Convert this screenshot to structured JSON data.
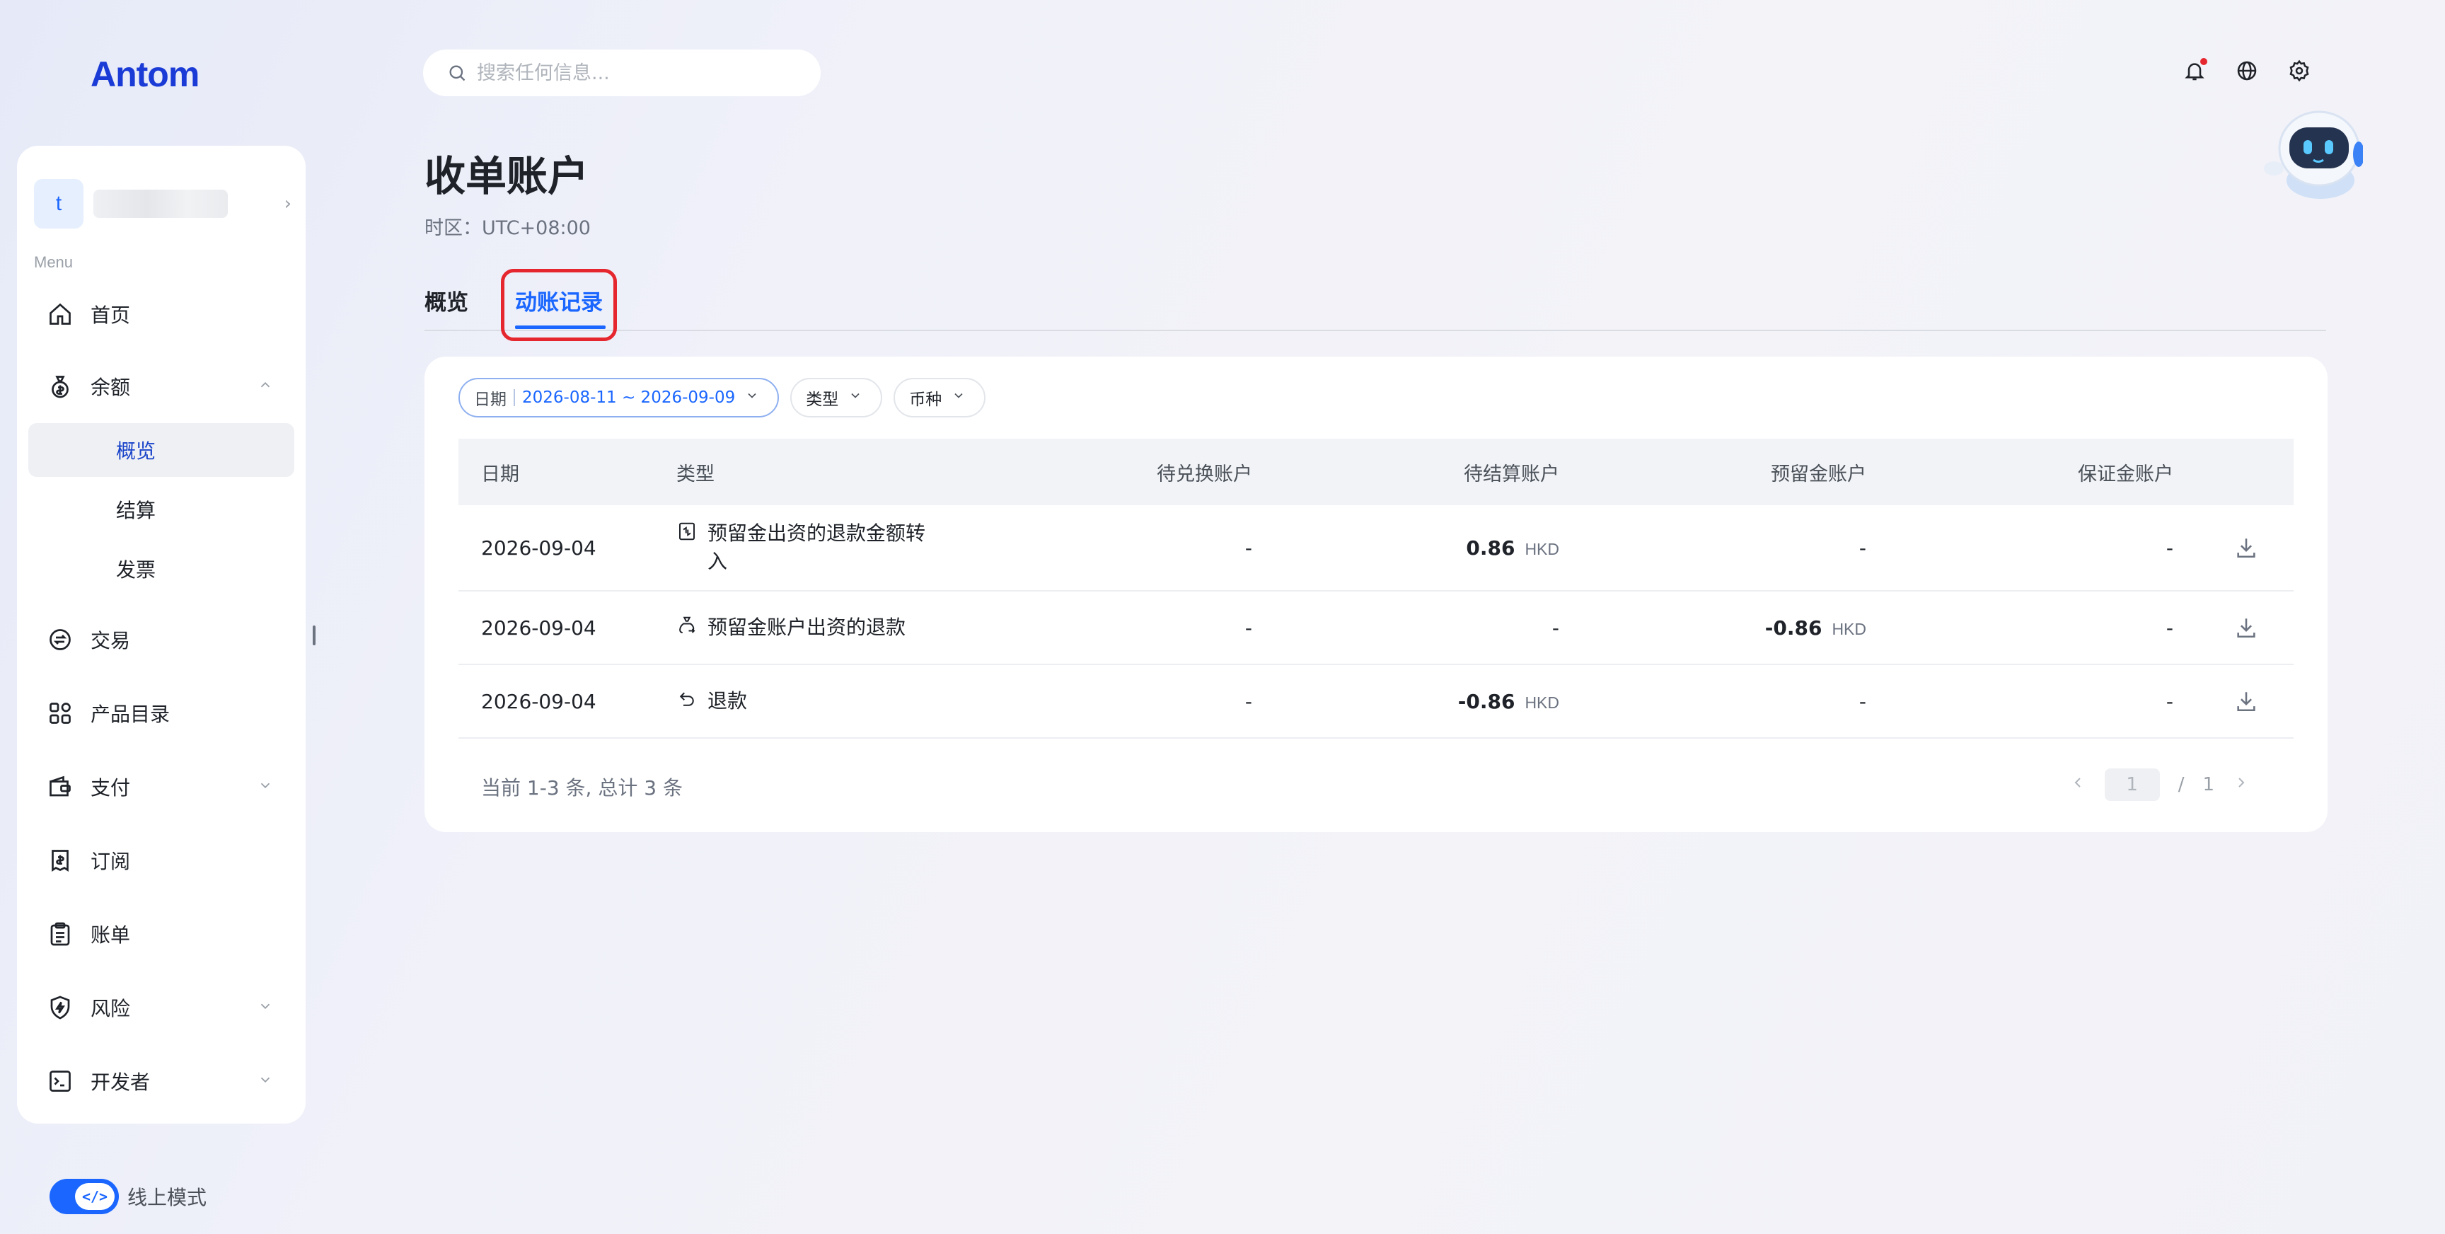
{
  "brand": {
    "logo_text": "Antom"
  },
  "sidebar": {
    "account_initial": "t",
    "menu_label": "Menu",
    "items": [
      {
        "label": "首页",
        "icon": "home-icon"
      },
      {
        "label": "余额",
        "icon": "money-bag-icon",
        "expanded": true,
        "children": [
          {
            "label": "概览",
            "active": true
          },
          {
            "label": "结算"
          },
          {
            "label": "发票"
          }
        ]
      },
      {
        "label": "交易",
        "icon": "exchange-icon"
      },
      {
        "label": "产品目录",
        "icon": "grid-icon"
      },
      {
        "label": "支付",
        "icon": "wallet-icon",
        "expandable": true
      },
      {
        "label": "订阅",
        "icon": "receipt-icon"
      },
      {
        "label": "账单",
        "icon": "clipboard-icon"
      },
      {
        "label": "风险",
        "icon": "shield-icon",
        "expandable": true
      },
      {
        "label": "开发者",
        "icon": "terminal-icon",
        "expandable": true
      }
    ],
    "mode_label": "线上模式",
    "mode_on": true
  },
  "search": {
    "placeholder": "搜索任何信息..."
  },
  "page": {
    "title": "收单账户",
    "timezone": "时区：UTC+08:00",
    "tabs": [
      {
        "label": "概览"
      },
      {
        "label": "动账记录",
        "active": true
      }
    ]
  },
  "filters": {
    "date_key": "日期",
    "date_value": "2026-08-11 ~ 2026-09-09",
    "type_label": "类型",
    "currency_label": "币种"
  },
  "table": {
    "headers": {
      "date": "日期",
      "type": "类型",
      "pending_fx": "待兑换账户",
      "pending_settle": "待结算账户",
      "reserve": "预留金账户",
      "deposit": "保证金账户"
    },
    "rows": [
      {
        "date": "2026-09-04",
        "type": "预留金出资的退款金额转入",
        "type_icon": "transfer-doc-icon",
        "pending_fx": "-",
        "pending_settle": "0.86",
        "pending_settle_cur": "HKD",
        "reserve": "-",
        "deposit": "-"
      },
      {
        "date": "2026-09-04",
        "type": "预留金账户出资的退款",
        "type_icon": "money-bag-refund-icon",
        "pending_fx": "-",
        "pending_settle": "-",
        "reserve": "-0.86",
        "reserve_cur": "HKD",
        "deposit": "-"
      },
      {
        "date": "2026-09-04",
        "type": "退款",
        "type_icon": "undo-icon",
        "pending_fx": "-",
        "pending_settle": "-0.86",
        "pending_settle_cur": "HKD",
        "reserve": "-",
        "deposit": "-"
      }
    ]
  },
  "pagination": {
    "summary": "当前 1-3 条, 总计 3 条",
    "current": "1",
    "separator": "/",
    "total": "1"
  },
  "colors": {
    "accent": "#1a66ff",
    "highlight": "#e5262e",
    "brand": "#1a3bd6"
  }
}
